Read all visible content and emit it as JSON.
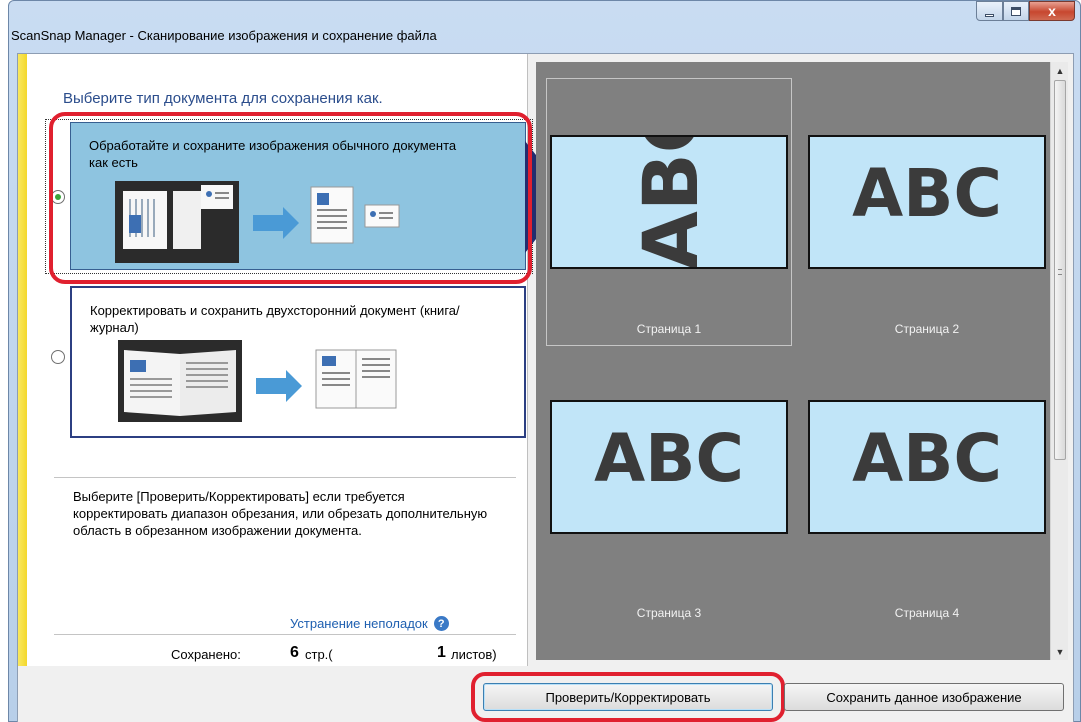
{
  "window": {
    "title": "ScanSnap Manager - Сканирование изображения и сохранение файла",
    "close_glyph": "x"
  },
  "left_panel": {
    "prompt": "Выберите тип документа для сохранения как.",
    "options": [
      {
        "label": "Обработайте и сохраните изображения обычного документа как есть",
        "selected": true
      },
      {
        "label": "Корректировать  и сохранить двухсторонний документ  (книга/журнал)",
        "selected": false
      }
    ],
    "info": "Выберите [Проверить/Корректировать] если требуется корректировать диапазон обрезания, или обрезать дополнительную область в обрезанном изображении документа.",
    "troubleshoot_link": "Устранение неполадок",
    "help_glyph": "?",
    "saved": {
      "label": "Сохранено:",
      "pages": "6",
      "pages_unit": "стр.(",
      "sheets": "1",
      "sheets_unit": "листов)"
    }
  },
  "thumbnails": [
    {
      "text": "ABC",
      "label": "Страница 1",
      "rotated": true,
      "selected": true
    },
    {
      "text": "ABC",
      "label": "Страница 2",
      "rotated": false,
      "selected": false
    },
    {
      "text": "ABC",
      "label": "Страница 3",
      "rotated": false,
      "selected": false
    },
    {
      "text": "ABC",
      "label": "Страница 4",
      "rotated": false,
      "selected": false
    }
  ],
  "buttons": {
    "check_correct": "Проверить/Корректировать",
    "save_image": "Сохранить данное изображение"
  },
  "colors": {
    "selected_option_bg": "#8ec4e0",
    "highlight_ring": "#e0202f",
    "link": "#1e5fb0",
    "page_bg": "#c1e5f8",
    "preview_bg": "#808080"
  }
}
